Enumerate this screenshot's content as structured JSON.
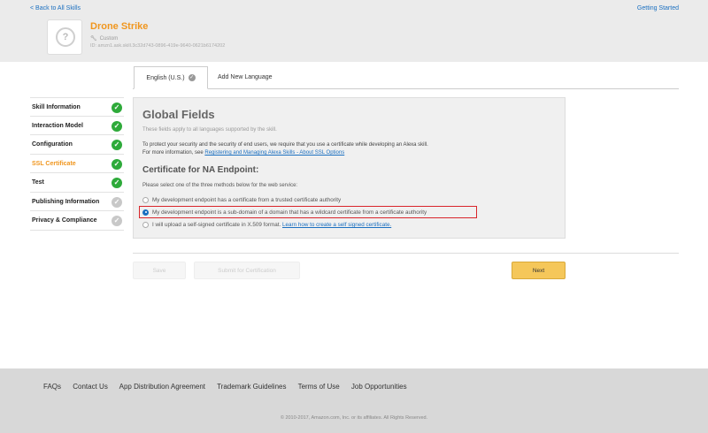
{
  "header": {
    "back_link": "< Back to All Skills",
    "getting_started": "Getting Started",
    "skill_name": "Drone Strike",
    "skill_type": "Custom",
    "skill_id": "ID:  amzn1.ask.skill.3c32d743-0896-419e-9640-0621b6174202",
    "icon": "speech-bubble-question-icon"
  },
  "language_tabs": {
    "active": "English (U.S.)",
    "add": "Add New Language"
  },
  "sidebar": {
    "items": [
      {
        "label": "Skill Information",
        "status": "done"
      },
      {
        "label": "Interaction Model",
        "status": "done"
      },
      {
        "label": "Configuration",
        "status": "done"
      },
      {
        "label": "SSL Certificate",
        "status": "done",
        "current": true
      },
      {
        "label": "Test",
        "status": "done"
      },
      {
        "label": "Publishing Information",
        "status": "pending"
      },
      {
        "label": "Privacy & Compliance",
        "status": "pending"
      }
    ]
  },
  "panel": {
    "title": "Global Fields",
    "subtitle": "These fields apply to all languages supported by the skill.",
    "text1": "To protect your security and the security of end users, we require that you use a certificate while developing an Alexa skill.",
    "text2_prefix": "For more information, see ",
    "text2_link": "Registering and Managing Alexa Skills - About SSL Options",
    "cert_heading": "Certificate for NA Endpoint:",
    "cert_sub": "Please select one of the three methods below for the web service:",
    "options": [
      {
        "label": "My development endpoint has a certificate from a trusted certificate authority",
        "checked": false
      },
      {
        "label": "My development endpoint is a sub-domain of a domain that has a wildcard certificate from a certificate authority",
        "checked": true
      },
      {
        "label": "I will upload a self-signed certificate in X.509 format. ",
        "link": "Learn how to create a self signed certificate.",
        "checked": false
      }
    ]
  },
  "buttons": {
    "save": "Save",
    "submit": "Submit for Certification",
    "next": "Next"
  },
  "footer": {
    "links": [
      "FAQs",
      "Contact Us",
      "App Distribution Agreement",
      "Trademark Guidelines",
      "Terms of Use",
      "Job Opportunities"
    ],
    "copyright": "© 2010-2017, Amazon.com, Inc. or its affiliates. All Rights Reserved."
  },
  "colors": {
    "accent_orange": "#f0961e",
    "link_blue": "#1a6fc0",
    "check_green": "#2eaa3a",
    "next_button": "#f5c75a",
    "highlight_red": "#d9252b"
  }
}
